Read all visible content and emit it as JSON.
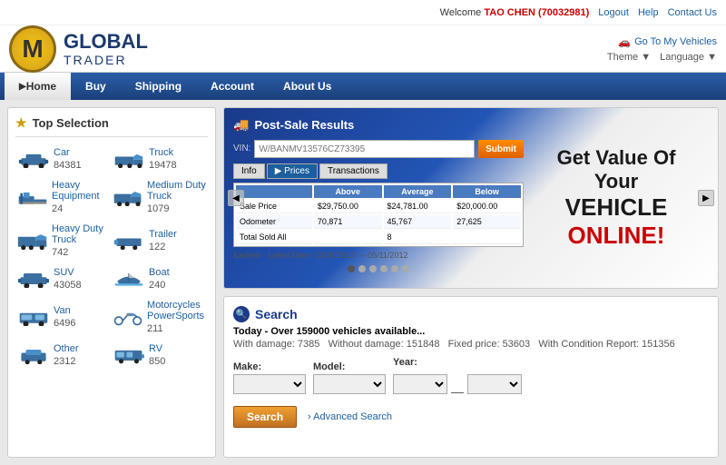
{
  "header": {
    "logo_letter": "M",
    "brand_top": "GLOBAL",
    "brand_bottom": "TRADER",
    "welcome_prefix": "Welcome",
    "username": "TAO CHEN (70032981)",
    "logout": "Logout",
    "help": "Help",
    "contact_us": "Contact Us",
    "go_to_vehicles": "Go To My Vehicles",
    "theme_label": "Theme",
    "language_label": "Language"
  },
  "nav": {
    "items": [
      {
        "label": "Home",
        "active": true
      },
      {
        "label": "Buy",
        "active": false
      },
      {
        "label": "Shipping",
        "active": false
      },
      {
        "label": "Account",
        "active": false
      },
      {
        "label": "About Us",
        "active": false
      }
    ]
  },
  "sidebar": {
    "title": "Top Selection",
    "vehicles": [
      {
        "name": "Car",
        "count": "84381",
        "type": "car"
      },
      {
        "name": "Truck",
        "count": "19478",
        "type": "truck"
      },
      {
        "name": "Heavy Equipment",
        "count": "24",
        "type": "heavy"
      },
      {
        "name": "Medium Duty Truck",
        "count": "1079",
        "type": "medium"
      },
      {
        "name": "Heavy Duty Truck",
        "count": "742",
        "type": "heavyduty"
      },
      {
        "name": "Trailer",
        "count": "122",
        "type": "trailer"
      },
      {
        "name": "SUV",
        "count": "43058",
        "type": "suv"
      },
      {
        "name": "Boat",
        "count": "240",
        "type": "boat"
      },
      {
        "name": "Van",
        "count": "6496",
        "type": "van"
      },
      {
        "name": "Motorcycles PowerSports",
        "count": "211",
        "type": "moto"
      },
      {
        "name": "Other",
        "count": "2312",
        "type": "other"
      },
      {
        "name": "RV",
        "count": "850",
        "type": "rv"
      }
    ]
  },
  "banner": {
    "post_sale_title": "Post-Sale Results",
    "vin_label": "VIN:",
    "vin_placeholder": "W/BANMV13576CZ73395",
    "submit_label": "Submit",
    "tabs": [
      "Info",
      "Prices",
      "Transactions"
    ],
    "table": {
      "headers": [
        "",
        "Above",
        "Average",
        "Below"
      ],
      "rows": [
        [
          "Sale Price",
          "$29,750.00",
          "$24,781.00",
          "$20,000.00"
        ],
        [
          "Odometer",
          "70,871",
          "45,767",
          "27,625"
        ],
        [
          "Total Sold All",
          "",
          "8",
          ""
        ]
      ],
      "date_row": "Earliest - Latest Date: 03/28/2012 — 05/11/2012"
    },
    "promo_line1": "Get Value Of Your",
    "promo_line2_prefix": "VEHICLE ",
    "promo_line2_highlight": "ONLINE!"
  },
  "search": {
    "title": "Search",
    "stats_line1": "Today - Over 159000 vehicles available...",
    "stats_line2_damage": "With damage: 7385",
    "stats_line2_nodamage": "Without damage: 151848",
    "stats_line2_fixed": "Fixed price: 53603",
    "stats_line2_condition": "With Condition Report: 151356",
    "make_label": "Make:",
    "model_label": "Model:",
    "year_label": "Year:",
    "make_placeholder": "",
    "model_placeholder": "",
    "year_placeholder": "",
    "search_btn": "Search",
    "advanced_link": "Advanced Search"
  }
}
